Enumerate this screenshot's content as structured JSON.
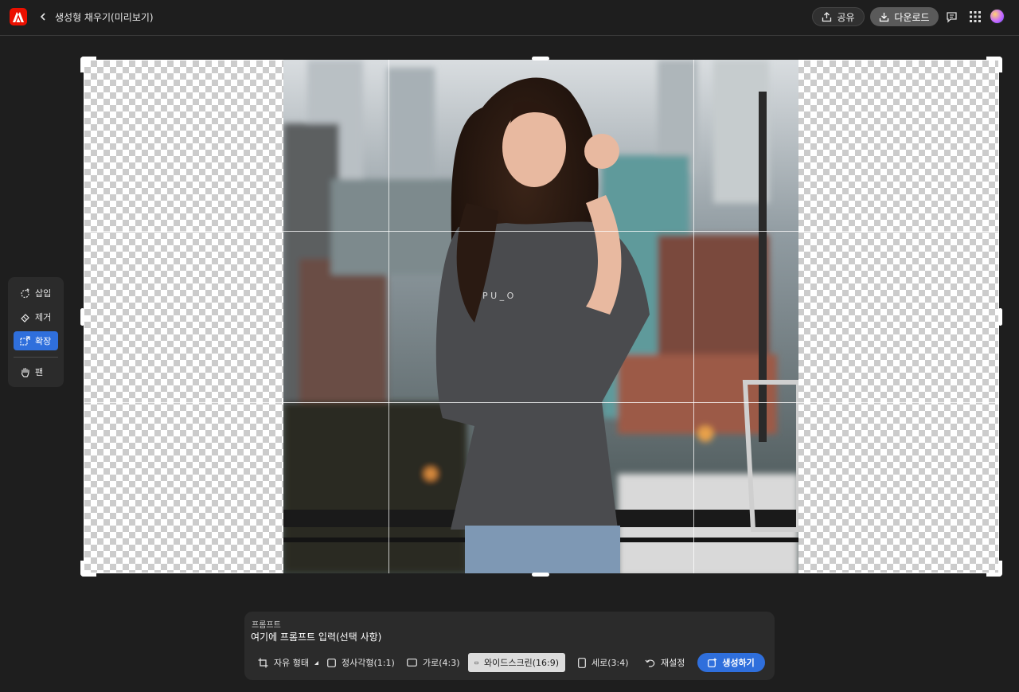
{
  "header": {
    "title": "생성형 채우기(미리보기)",
    "share_label": "공유",
    "download_label": "다운로드",
    "icons": [
      "adobe-logo-icon",
      "back-chevron-icon",
      "share-icon",
      "download-icon",
      "comment-icon",
      "apps-grid-icon",
      "avatar"
    ]
  },
  "tools": {
    "items": [
      {
        "label": "삽입",
        "icon": "insert-icon",
        "active": false
      },
      {
        "label": "제거",
        "icon": "eraser-icon",
        "active": false
      },
      {
        "label": "확장",
        "icon": "expand-icon",
        "active": true
      },
      {
        "label": "팬",
        "icon": "hand-icon",
        "active": false
      }
    ]
  },
  "prompt": {
    "label": "프롬프트",
    "placeholder": "여기에 프롬프트 입력(선택 사항)",
    "value": ""
  },
  "aspect_options": [
    {
      "label": "자유 형태",
      "icon": "crop-icon",
      "selected": false
    },
    {
      "label": "정사각형(1:1)",
      "icon": "square-icon",
      "selected": false
    },
    {
      "label": "가로(4:3)",
      "icon": "landscape-icon",
      "selected": false
    },
    {
      "label": "와이드스크린(16:9)",
      "icon": "widescreen-icon",
      "selected": true
    },
    {
      "label": "세로(3:4)",
      "icon": "portrait-icon",
      "selected": false
    },
    {
      "label": "재설정",
      "icon": "reset-icon",
      "selected": false
    }
  ],
  "generate_label": "생성하기",
  "colors": {
    "background": "#1e1e1e",
    "panel": "#2b2b2b",
    "accent": "#2f6fdc",
    "brand": "#eb1000"
  }
}
